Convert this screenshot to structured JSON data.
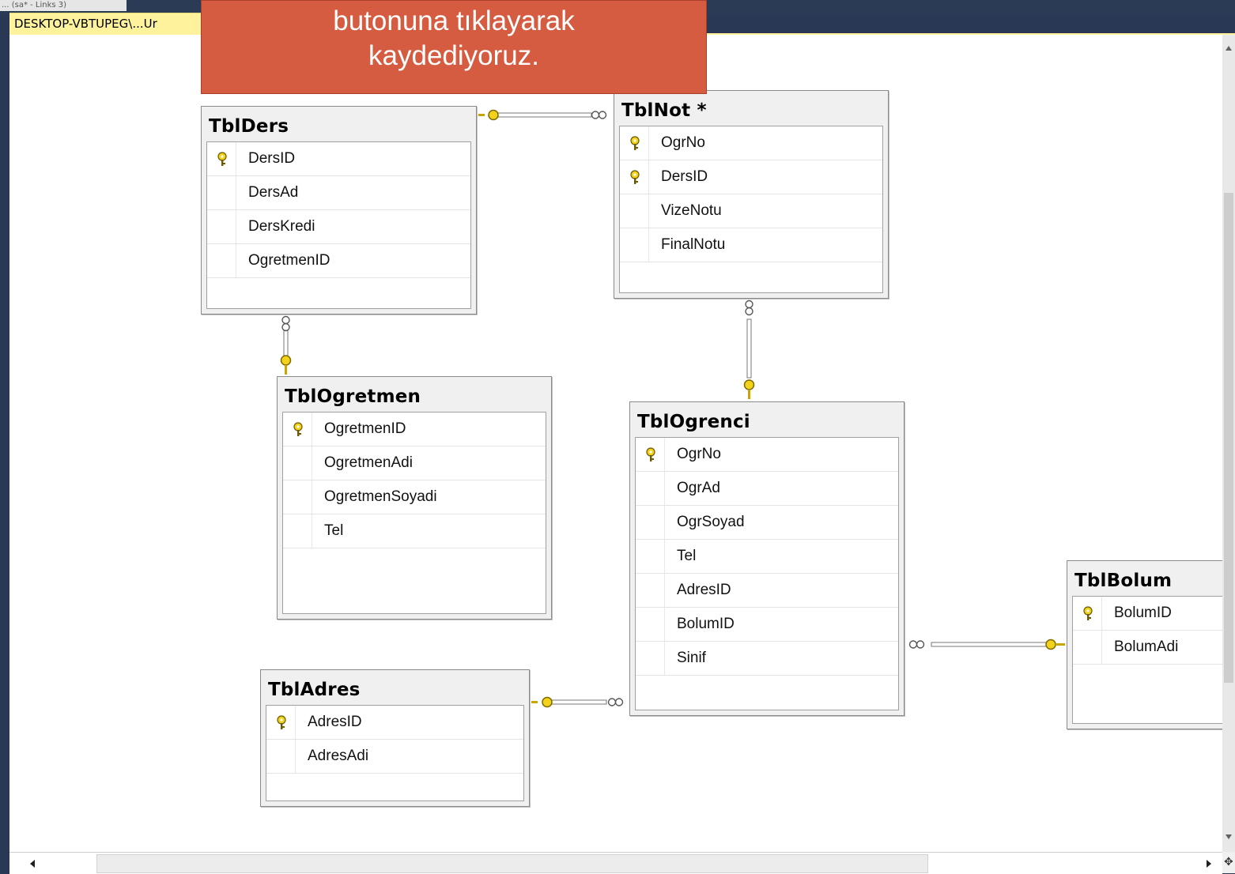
{
  "window": {
    "top_tab_label": "... (sa* - Links 3)",
    "document_tab_label": "DESKTOP-VBTUPEG\\...Ur"
  },
  "callout": {
    "line1": "butonuna tıklayarak",
    "line2": "kaydediyoruz."
  },
  "tables": {
    "ders": {
      "title": "TblDers",
      "columns": [
        {
          "name": "DersID",
          "pk": true
        },
        {
          "name": "DersAd",
          "pk": false
        },
        {
          "name": "DersKredi",
          "pk": false
        },
        {
          "name": "OgretmenID",
          "pk": false
        }
      ]
    },
    "not": {
      "title": "TblNot *",
      "columns": [
        {
          "name": "OgrNo",
          "pk": true
        },
        {
          "name": "DersID",
          "pk": true
        },
        {
          "name": "VizeNotu",
          "pk": false
        },
        {
          "name": "FinalNotu",
          "pk": false
        }
      ]
    },
    "ogretmen": {
      "title": "TblOgretmen",
      "columns": [
        {
          "name": "OgretmenID",
          "pk": true
        },
        {
          "name": "OgretmenAdi",
          "pk": false
        },
        {
          "name": "OgretmenSoyadi",
          "pk": false
        },
        {
          "name": "Tel",
          "pk": false
        }
      ]
    },
    "ogrenci": {
      "title": "TblOgrenci",
      "columns": [
        {
          "name": "OgrNo",
          "pk": true
        },
        {
          "name": "OgrAd",
          "pk": false
        },
        {
          "name": "OgrSoyad",
          "pk": false
        },
        {
          "name": "Tel",
          "pk": false
        },
        {
          "name": "AdresID",
          "pk": false
        },
        {
          "name": "BolumID",
          "pk": false
        },
        {
          "name": "Sinif",
          "pk": false
        }
      ]
    },
    "adres": {
      "title": "TblAdres",
      "columns": [
        {
          "name": "AdresID",
          "pk": true
        },
        {
          "name": "AdresAdi",
          "pk": false
        }
      ]
    },
    "bolum": {
      "title": "TblBolum",
      "columns": [
        {
          "name": "BolumID",
          "pk": true
        },
        {
          "name": "BolumAdi",
          "pk": false
        }
      ]
    }
  },
  "relationships": [
    {
      "one": "TblDers",
      "many": "TblNot"
    },
    {
      "one": "TblOgretmen",
      "many": "TblDers"
    },
    {
      "one": "TblOgrenci",
      "many": "TblNot"
    },
    {
      "one": "TblAdres",
      "many": "TblOgrenci"
    },
    {
      "one": "TblBolum",
      "many": "TblOgrenci"
    }
  ],
  "colors": {
    "key": "#f2d21b",
    "callout": "#d55c40",
    "chrome": "#293955",
    "tab_highlight": "#fff29d"
  },
  "icons": {
    "primary_key": "key-icon",
    "relationship_one": "key-end-icon",
    "relationship_many": "infinity-icon"
  }
}
